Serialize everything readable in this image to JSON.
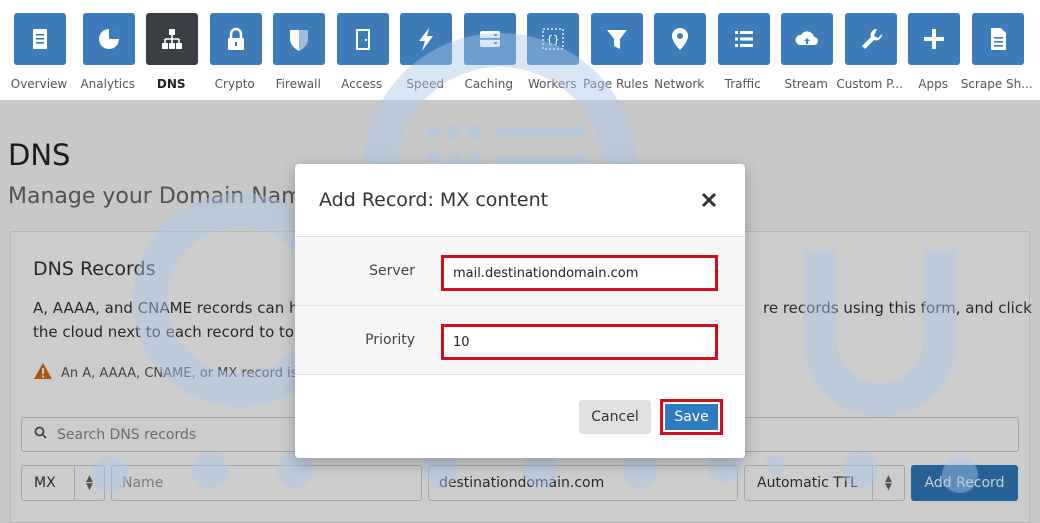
{
  "nav": {
    "items": [
      {
        "label": "Overview",
        "icon": "document-icon",
        "active": false
      },
      {
        "label": "Analytics",
        "icon": "pie-chart-icon",
        "active": false
      },
      {
        "label": "DNS",
        "icon": "network-icon",
        "active": true
      },
      {
        "label": "Crypto",
        "icon": "lock-icon",
        "active": false
      },
      {
        "label": "Firewall",
        "icon": "shield-icon",
        "active": false
      },
      {
        "label": "Access",
        "icon": "door-icon",
        "active": false
      },
      {
        "label": "Speed",
        "icon": "lightning-icon",
        "active": false
      },
      {
        "label": "Caching",
        "icon": "server-icon",
        "active": false
      },
      {
        "label": "Workers",
        "icon": "code-braces-icon",
        "active": false
      },
      {
        "label": "Page Rules",
        "icon": "filter-icon",
        "active": false
      },
      {
        "label": "Network",
        "icon": "location-pin-icon",
        "active": false
      },
      {
        "label": "Traffic",
        "icon": "list-icon",
        "active": false
      },
      {
        "label": "Stream",
        "icon": "cloud-upload-icon",
        "active": false
      },
      {
        "label": "Custom P...",
        "icon": "wrench-icon",
        "active": false
      },
      {
        "label": "Apps",
        "icon": "plus-icon",
        "active": false
      },
      {
        "label": "Scrape Sh...",
        "icon": "page-icon",
        "active": false
      }
    ],
    "tile_color": "#3d7cb8",
    "active_tile_color": "#3a3f45"
  },
  "page": {
    "title": "DNS",
    "subtitle": "Manage your Domain Name",
    "card": {
      "title": "DNS Records",
      "desc_line1": "A, AAAA, and CNAME records can ha",
      "desc_line1_tail": "re records using this form, and click",
      "desc_line2": "the cloud next to each record to tog",
      "warning": "An A, AAAA, CNAME, or MX record is"
    },
    "search": {
      "placeholder": "Search DNS records"
    },
    "add_row": {
      "type_value": "MX",
      "name_placeholder": "Name",
      "content_value": "destinationdomain.com",
      "ttl_value": "Automatic TTL",
      "add_button": "Add Record"
    }
  },
  "modal": {
    "title": "Add Record: MX content",
    "fields": [
      {
        "label": "Server",
        "value": "mail.destinationdomain.com"
      },
      {
        "label": "Priority",
        "value": "10"
      }
    ],
    "cancel_label": "Cancel",
    "save_label": "Save",
    "highlight_color": "#d0111b",
    "primary_color": "#2f7bbf"
  }
}
